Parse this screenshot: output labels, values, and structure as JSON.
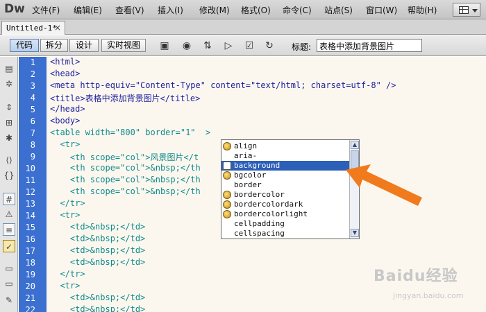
{
  "app": {
    "logo": "Dw"
  },
  "menu": [
    {
      "label": "文件(F)"
    },
    {
      "label": "编辑(E)"
    },
    {
      "label": "查看(V)"
    },
    {
      "label": "插入(I)"
    },
    {
      "label": "修改(M)"
    },
    {
      "label": "格式(O)"
    },
    {
      "label": "命令(C)"
    },
    {
      "label": "站点(S)"
    },
    {
      "label": "窗口(W)"
    },
    {
      "label": "帮助(H)"
    }
  ],
  "tab": {
    "name": "Untitled-1*",
    "close": "×"
  },
  "toolbar": {
    "views": [
      {
        "label": "代码"
      },
      {
        "label": "拆分"
      },
      {
        "label": "设计"
      },
      {
        "label": "实时视图"
      }
    ],
    "title_label": "标题:",
    "title_value": "表格中添加背景图片",
    "icons": [
      "file-management-icon",
      "preview-browser-icon",
      "file-transfer-icon",
      "visual-aids-icon",
      "validate-icon",
      "refresh-icon"
    ]
  },
  "editor": {
    "line_numbers": [
      "1",
      "2",
      "3",
      "4",
      "5",
      "6",
      "7",
      "8",
      "9",
      "10",
      "11",
      "12",
      "13",
      "14",
      "15",
      "16",
      "17",
      "18",
      "19",
      "20",
      "21",
      "22"
    ],
    "lines": [
      "<html>",
      "<head>",
      "<meta http-equiv=\"Content-Type\" content=\"text/html; charset=utf-8\" />",
      "<title>表格中添加背景图片</title>",
      "</head>",
      "<body>",
      "<table width=\"800\" border=\"1\"  >",
      "  <tr>",
      "    <th scope=\"col\">风景图片</t",
      "    <th scope=\"col\">&nbsp;</th",
      "    <th scope=\"col\">&nbsp;</th",
      "    <th scope=\"col\">&nbsp;</th",
      "  </tr>",
      "  <tr>",
      "    <td>&nbsp;</td>",
      "    <td>&nbsp;</td>",
      "    <td>&nbsp;</td>",
      "    <td>&nbsp;</td>",
      "  </tr>",
      "  <tr>",
      "    <td>&nbsp;</td>",
      "    <td>&nbsp;</td>"
    ]
  },
  "hint": {
    "items": [
      {
        "label": "align",
        "icon": "attribute-icon"
      },
      {
        "label": "aria-",
        "icon": "none"
      },
      {
        "label": "background",
        "icon": "browse-icon",
        "selected": true
      },
      {
        "label": "bgcolor",
        "icon": "attribute-icon"
      },
      {
        "label": "border",
        "icon": "none"
      },
      {
        "label": "bordercolor",
        "icon": "attribute-icon"
      },
      {
        "label": "bordercolordark",
        "icon": "attribute-icon"
      },
      {
        "label": "bordercolorlight",
        "icon": "attribute-icon"
      },
      {
        "label": "cellpadding",
        "icon": "none"
      },
      {
        "label": "cellspacing",
        "icon": "none"
      }
    ]
  },
  "annotation": {
    "color": "#f07a1c"
  },
  "watermark": {
    "brand": "Baidu经验",
    "site": "jingyan.baidu.com"
  },
  "colors": {
    "gutter": "#3b6fd0",
    "selection": "#2c5fb8",
    "editor_bg": "#fbf7ef"
  }
}
